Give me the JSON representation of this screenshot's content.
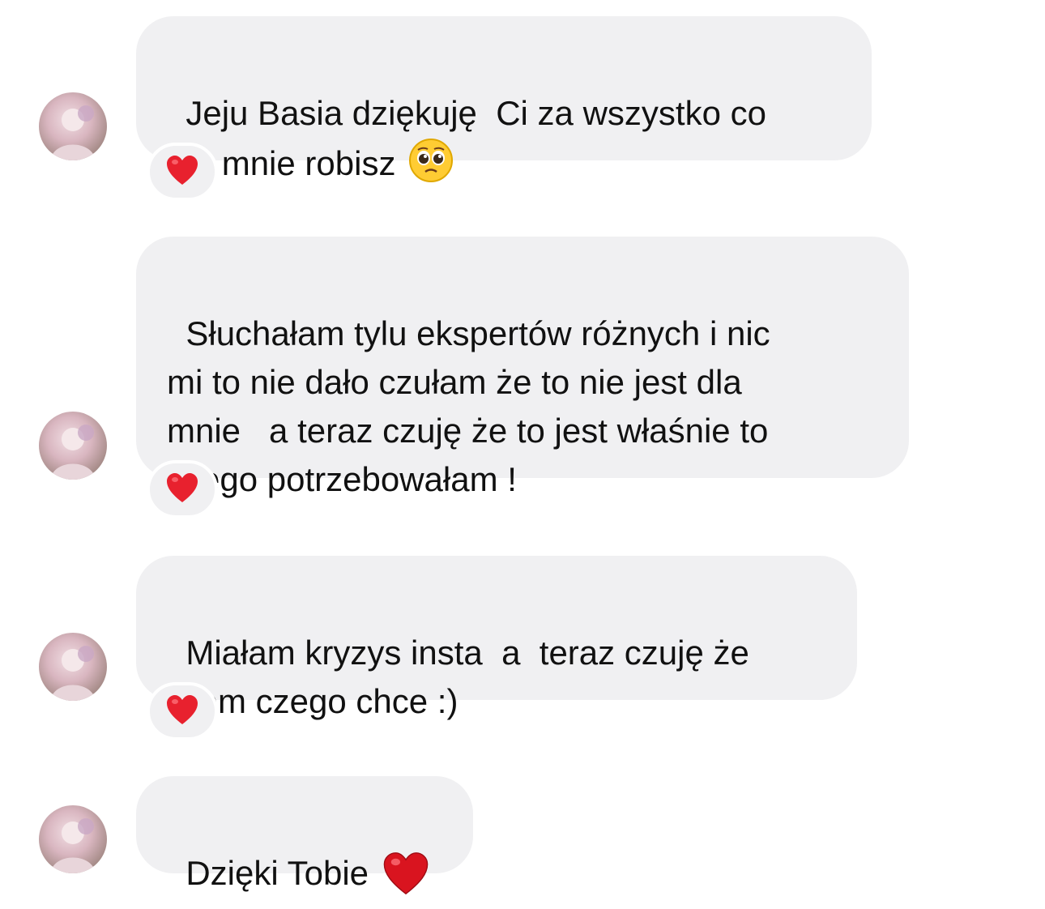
{
  "messages": [
    {
      "text": "Jeju Basia dziękuję  Ci za wszystko co\ndla mnie robisz",
      "trailing_emoji": "pleading-face",
      "reaction": "red-heart"
    },
    {
      "text": "Słuchałam tylu ekspertów różnych i nic\nmi to nie dało czułam że to nie jest dla\nmnie   a teraz czuję że to jest właśnie to\nczego potrzebowałam !",
      "reaction": "red-heart"
    },
    {
      "text": "Miałam kryzys insta  a  teraz czuję że\nwiem czego chce :)",
      "reaction": "red-heart"
    },
    {
      "text": "Dzięki Tobie",
      "trailing_emoji": "red-heart"
    }
  ],
  "colors": {
    "bubble_bg": "#f0f0f2",
    "text": "#111111",
    "heart": "#e8212e"
  }
}
